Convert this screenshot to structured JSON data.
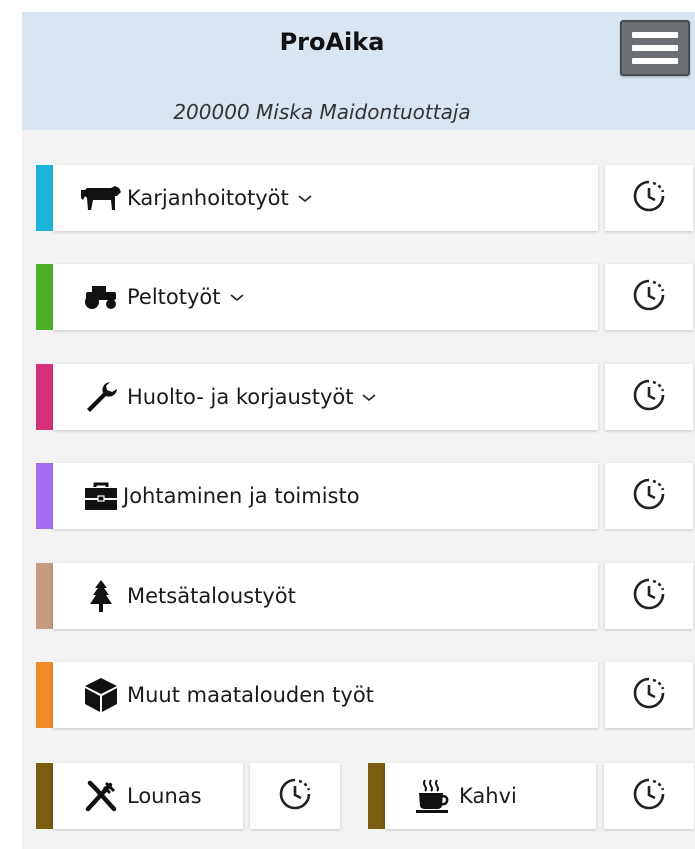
{
  "header": {
    "title": "ProAika",
    "user": "200000 Miska Maidontuottaja",
    "menu_icon": "hamburger-menu-icon",
    "background": "#d9e6f2"
  },
  "categories": [
    {
      "label": "Karjanhoitotyöt",
      "color": "#1bb4d8",
      "icon": "cow-icon",
      "expandable": true
    },
    {
      "label": "Peltotyöt",
      "color": "#4caf2a",
      "icon": "tractor-icon",
      "expandable": true
    },
    {
      "label": "Huolto- ja korjaustyöt",
      "color": "#d6307a",
      "icon": "wrench-icon",
      "expandable": true
    },
    {
      "label": "Johtaminen ja toimisto",
      "color": "#a56df0",
      "icon": "briefcase-icon",
      "expandable": false
    },
    {
      "label": "Metsätaloustyöt",
      "color": "#c49a80",
      "icon": "tree-icon",
      "expandable": false
    },
    {
      "label": "Muut maatalouden työt",
      "color": "#f08a2a",
      "icon": "cube-icon",
      "expandable": false
    }
  ],
  "breaks": [
    {
      "label": "Lounas",
      "color": "#7a5c12",
      "icon": "fork-knife-icon"
    },
    {
      "label": "Kahvi",
      "color": "#7a5c12",
      "icon": "coffee-icon"
    }
  ],
  "timer_icon": "clock-history-icon"
}
